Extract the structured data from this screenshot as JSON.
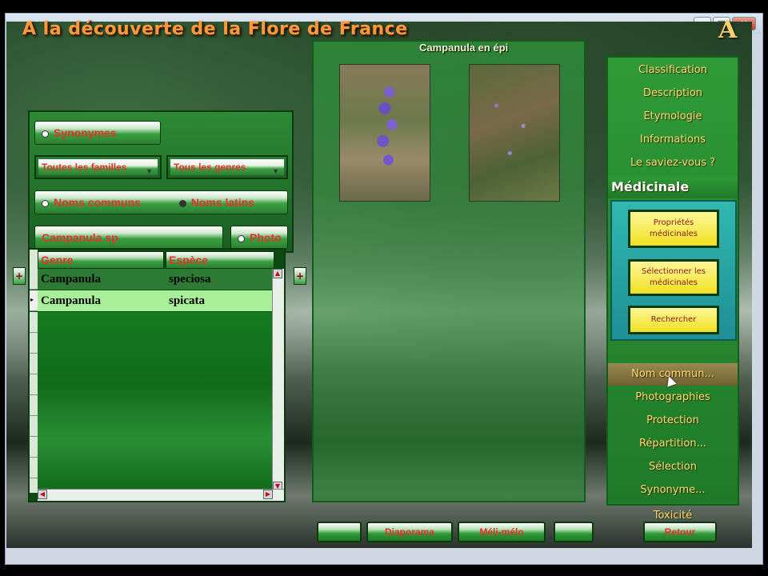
{
  "app": {
    "title": "A la découverte de la Flore de France",
    "logo": "A"
  },
  "window_controls": {
    "minimize": "–",
    "maximize": "□",
    "close": "✕"
  },
  "filters": {
    "synonymes_label": "Synonymes",
    "family_select": "Toutes les familles",
    "genre_select": "Tous les genres",
    "radio_common": "Noms communs",
    "radio_latin": "Noms latins",
    "radio_selected": "latin",
    "search_value": "Campanula sp",
    "photo_label": "Photo"
  },
  "table": {
    "columns": [
      "Genre",
      "Espèce"
    ],
    "rows": [
      {
        "genre": "Campanula",
        "espece": "speciosa"
      },
      {
        "genre": "Campanula",
        "espece": "spicata"
      }
    ],
    "selected_row": 1,
    "add_left": "+",
    "add_right": "+"
  },
  "plant": {
    "name": "Campanula en épi"
  },
  "menu": {
    "items": [
      {
        "label": "Classification"
      },
      {
        "label": "Description"
      },
      {
        "label": "Etymologie"
      },
      {
        "label": "Informations"
      },
      {
        "label": "Le saviez-vous ?"
      }
    ],
    "section": "Médicinale",
    "medicinal_buttons": [
      {
        "label": "Propriétés médicinales"
      },
      {
        "label": "Sélectionner les médicinales"
      },
      {
        "label": "Rechercher"
      }
    ],
    "items_lower": [
      {
        "label": "Nom commun..."
      },
      {
        "label": "Photographies"
      },
      {
        "label": "Protection"
      },
      {
        "label": "Répartition..."
      },
      {
        "label": "Sélection"
      },
      {
        "label": "Synonyme..."
      },
      {
        "label": "Toxicité"
      }
    ],
    "hovered": "Nom commun..."
  },
  "bottom": {
    "btn1": "",
    "diaporama": "Diaporama",
    "meli_melo": "Méli-mélo",
    "btn4": "",
    "retour": "Retour"
  },
  "colors": {
    "accent_red": "#e4322b",
    "menu_yellow": "#ffd873",
    "panel_green": "#2f9a37",
    "title_orange": "#ff9a3c"
  }
}
